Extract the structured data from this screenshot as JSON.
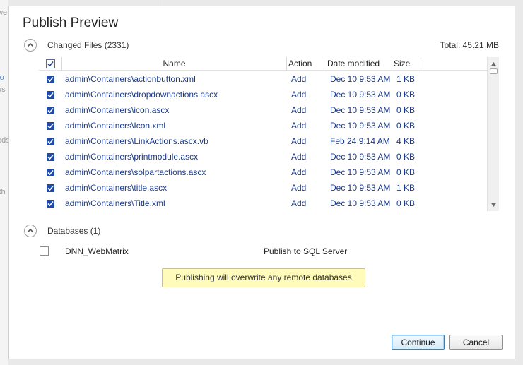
{
  "dialog": {
    "title": "Publish Preview"
  },
  "changed_files": {
    "label": "Changed Files (2331)",
    "total": "Total: 45.21 MB",
    "columns": {
      "name": "Name",
      "action": "Action",
      "date": "Date modified",
      "size": "Size"
    },
    "rows": [
      {
        "name": "admin\\Containers\\actionbutton.xml",
        "action": "Add",
        "date": "Dec 10 9:53 AM",
        "size": "1 KB",
        "checked": true
      },
      {
        "name": "admin\\Containers\\dropdownactions.ascx",
        "action": "Add",
        "date": "Dec 10 9:53 AM",
        "size": "0 KB",
        "checked": true
      },
      {
        "name": "admin\\Containers\\icon.ascx",
        "action": "Add",
        "date": "Dec 10 9:53 AM",
        "size": "0 KB",
        "checked": true
      },
      {
        "name": "admin\\Containers\\Icon.xml",
        "action": "Add",
        "date": "Dec 10 9:53 AM",
        "size": "0 KB",
        "checked": true
      },
      {
        "name": "admin\\Containers\\LinkActions.ascx.vb",
        "action": "Add",
        "date": "Feb 24 9:14 AM",
        "size": "4 KB",
        "checked": true
      },
      {
        "name": "admin\\Containers\\printmodule.ascx",
        "action": "Add",
        "date": "Dec 10 9:53 AM",
        "size": "0 KB",
        "checked": true
      },
      {
        "name": "admin\\Containers\\solpartactions.ascx",
        "action": "Add",
        "date": "Dec 10 9:53 AM",
        "size": "0 KB",
        "checked": true
      },
      {
        "name": "admin\\Containers\\title.ascx",
        "action": "Add",
        "date": "Dec 10 9:53 AM",
        "size": "1 KB",
        "checked": true
      },
      {
        "name": "admin\\Containers\\Title.xml",
        "action": "Add",
        "date": "Dec 10 9:53 AM",
        "size": "0 KB",
        "checked": true
      }
    ]
  },
  "databases": {
    "label": "Databases (1)",
    "items": [
      {
        "name": "DNN_WebMatrix",
        "target": "Publish to SQL Server",
        "checked": false
      }
    ],
    "warning": "Publishing will overwrite any remote databases"
  },
  "buttons": {
    "continue": "Continue",
    "cancel": "Cancel"
  },
  "background": {
    "fragments": [
      "we",
      "ro",
      "os",
      "eds",
      "ith"
    ]
  },
  "colors": {
    "link_text": "#1b3a8a",
    "warning_bg": "#fffbbb",
    "primary_border": "#3c7fb1"
  }
}
